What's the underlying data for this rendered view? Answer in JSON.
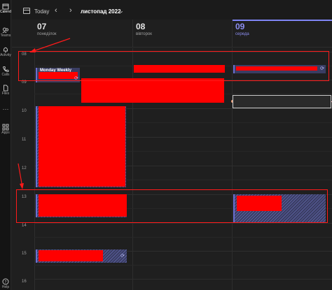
{
  "rail": {
    "items": [
      {
        "label": "Calendar",
        "icon": "calendar-icon",
        "active": true
      },
      {
        "label": "Teams",
        "icon": "teams-icon"
      },
      {
        "label": "Activity",
        "icon": "bell-icon"
      },
      {
        "label": "Calls",
        "icon": "phone-icon"
      },
      {
        "label": "Files",
        "icon": "file-icon"
      },
      {
        "label": "Apps",
        "icon": "apps-icon"
      },
      {
        "label": "Help",
        "icon": "help-icon"
      }
    ],
    "more": "···"
  },
  "toolbar": {
    "today_label": "Today",
    "prev": "‹",
    "next": "›",
    "month_label": "листопад 2022",
    "month_chevron": "⌄"
  },
  "days": [
    {
      "num": "07",
      "name": "понеділок",
      "today": false
    },
    {
      "num": "08",
      "name": "вівторок",
      "today": false
    },
    {
      "num": "09",
      "name": "середа",
      "today": true
    }
  ],
  "hours": [
    "08",
    "09",
    "10",
    "11",
    "12",
    "13",
    "14",
    "15",
    "16"
  ],
  "events": {
    "monday_weekly_title": "Monday Weekly",
    "recur_glyph": "⟳"
  },
  "colors": {
    "accent": "#7f85f5",
    "annotation": "#ff1a1a",
    "redaction": "#ff0000",
    "event_fill": "#3a3d63"
  }
}
